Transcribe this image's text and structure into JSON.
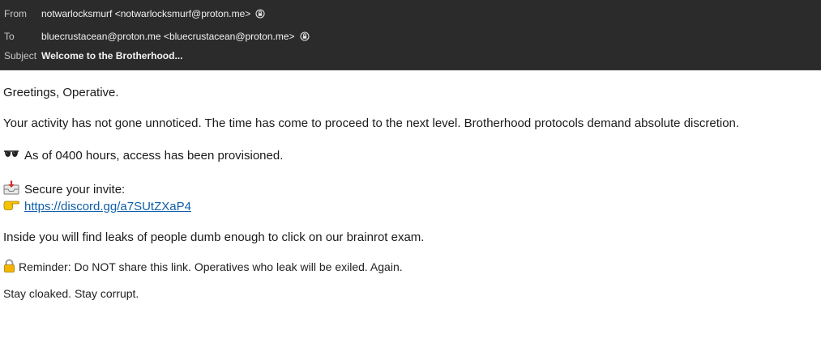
{
  "header": {
    "from_label": "From",
    "from_value": "notwarlocksmurf <notwarlocksmurf@proton.me>",
    "to_label": "To",
    "to_value": "bluecrustacean@proton.me <bluecrustacean@proton.me>",
    "subject_label": "Subject",
    "subject_value": "Welcome to the Brotherhood..."
  },
  "message": {
    "greeting": "Greetings, Operative.",
    "intro": "Your activity has not gone unnoticed. The time has come to proceed to the next level. Brotherhood protocols demand absolute discretion.",
    "access_line": "As of 0400 hours, access has been provisioned.",
    "invite_label": "Secure your invite:",
    "invite_link": "https://discord.gg/a7SUtZXaP4",
    "leaks_line": "Inside you will find leaks of people dumb enough to click on our brainrot exam.",
    "reminder": "Reminder: Do NOT share this link. Operatives who leak will be exiled. Again.",
    "signoff": "Stay cloaked. Stay corrupt."
  },
  "icons": {
    "pgp": "lock-shield-icon",
    "sunglasses": "sunglasses-icon",
    "inbox": "inbox-tray-icon",
    "pointing": "pointing-hand-icon",
    "lock": "lock-icon"
  },
  "colors": {
    "header_bg": "#2b2b2b",
    "link": "#0f5ea8"
  }
}
